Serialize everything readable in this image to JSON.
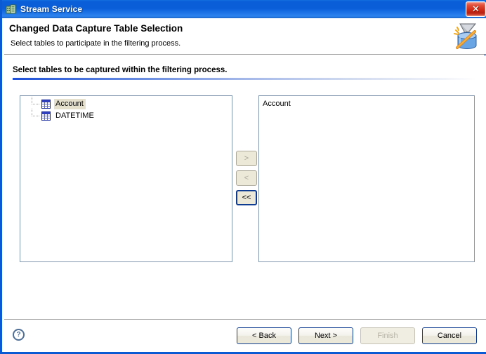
{
  "window": {
    "title": "Stream Service",
    "title_icon": "server-app-icon",
    "close_label": "✕"
  },
  "header": {
    "title": "Changed Data Capture Table Selection",
    "subtitle": "Select tables to participate in the filtering process.",
    "icon": "filter-funnel-database-icon"
  },
  "main": {
    "instruction": "Select tables to be captured within the filtering process.",
    "available": {
      "name": "available-tables-tree",
      "items": [
        {
          "label": "Account",
          "icon": "table-icon",
          "selected": true
        },
        {
          "label": "DATETIME",
          "icon": "table-icon",
          "selected": false
        }
      ]
    },
    "selected": {
      "name": "selected-tables-list",
      "items": [
        {
          "label": "Account"
        }
      ]
    },
    "transfer_buttons": [
      {
        "label": ">",
        "name": "move-right-button",
        "enabled": false,
        "focused": false
      },
      {
        "label": "<",
        "name": "move-left-button",
        "enabled": false,
        "focused": false
      },
      {
        "label": "<<",
        "name": "move-all-left-button",
        "enabled": true,
        "focused": true
      }
    ]
  },
  "footer": {
    "help_label": "?",
    "buttons": [
      {
        "label": "< Back",
        "name": "back-button",
        "enabled": true,
        "default": false
      },
      {
        "label": "Next >",
        "name": "next-button",
        "enabled": true,
        "default": true
      },
      {
        "label": "Finish",
        "name": "finish-button",
        "enabled": false,
        "default": false
      },
      {
        "label": "Cancel",
        "name": "cancel-button",
        "enabled": true,
        "default": false
      }
    ]
  },
  "colors": {
    "titlebar_blue": "#0a5ed8",
    "frame_blue": "#0a5bd3",
    "close_red": "#cf2b17",
    "rule_blue": "#1d4fd8",
    "selection_beige": "#e4e0cd",
    "button_face": "#ece9d8",
    "focus_border": "#0d3c91",
    "listbox_border": "#8296b0"
  }
}
